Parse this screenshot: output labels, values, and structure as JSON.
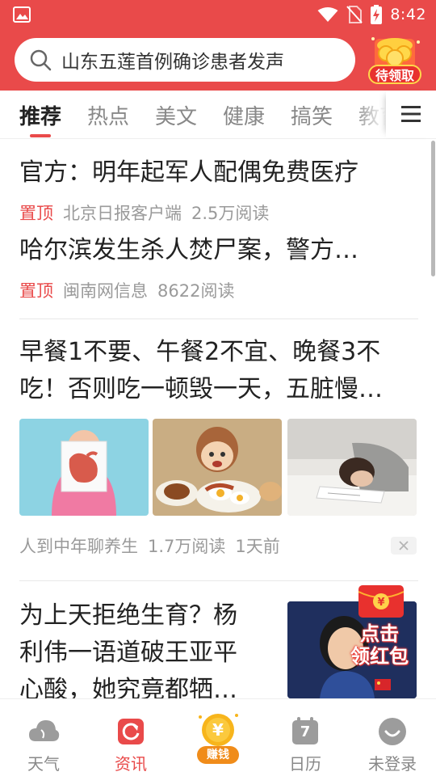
{
  "status_bar": {
    "time": "8:42"
  },
  "search": {
    "query": "山东五莲首例确诊患者发声"
  },
  "red_packet": {
    "label": "待领取"
  },
  "tabs": [
    {
      "label": "推荐",
      "active": true
    },
    {
      "label": "热点"
    },
    {
      "label": "美文"
    },
    {
      "label": "健康"
    },
    {
      "label": "搞笑"
    },
    {
      "label": "教育"
    }
  ],
  "feed": {
    "pinned": [
      {
        "title": "官方：明年起军人配偶免费医疗",
        "tag": "置顶",
        "source": "北京日报客户端",
        "reads": "2.5万阅读"
      },
      {
        "title": "哈尔滨发生杀人焚尸案，警方…",
        "tag": "置顶",
        "source": "闽南网信息",
        "reads": "8622阅读"
      }
    ],
    "article": {
      "title_lines": [
        "早餐1不要、午餐2不宜、晚餐3不",
        "吃！否则吃一顿毁一天，五脏慢…"
      ],
      "source": "人到中年聊养生",
      "reads": "1.7万阅读",
      "time": "1天前"
    },
    "ad_article": {
      "title_lines": [
        "为上天拒绝生育？杨",
        "利伟一语道破王亚平",
        "心酸，她究竟都牺…"
      ],
      "badge_line1": "点击",
      "badge_line2": "领红包"
    }
  },
  "bottom_nav": [
    {
      "label": "天气",
      "icon": "cloud-icon"
    },
    {
      "label": "资讯",
      "icon": "refresh-icon",
      "active": true
    },
    {
      "label": "赚钱",
      "icon": "coin-icon"
    },
    {
      "label": "日历",
      "icon": "calendar-icon",
      "day": "7"
    },
    {
      "label": "未登录",
      "icon": "avatar-icon"
    }
  ],
  "colors": {
    "brand_red": "#e94a4a",
    "gold": "#f7b51c"
  }
}
